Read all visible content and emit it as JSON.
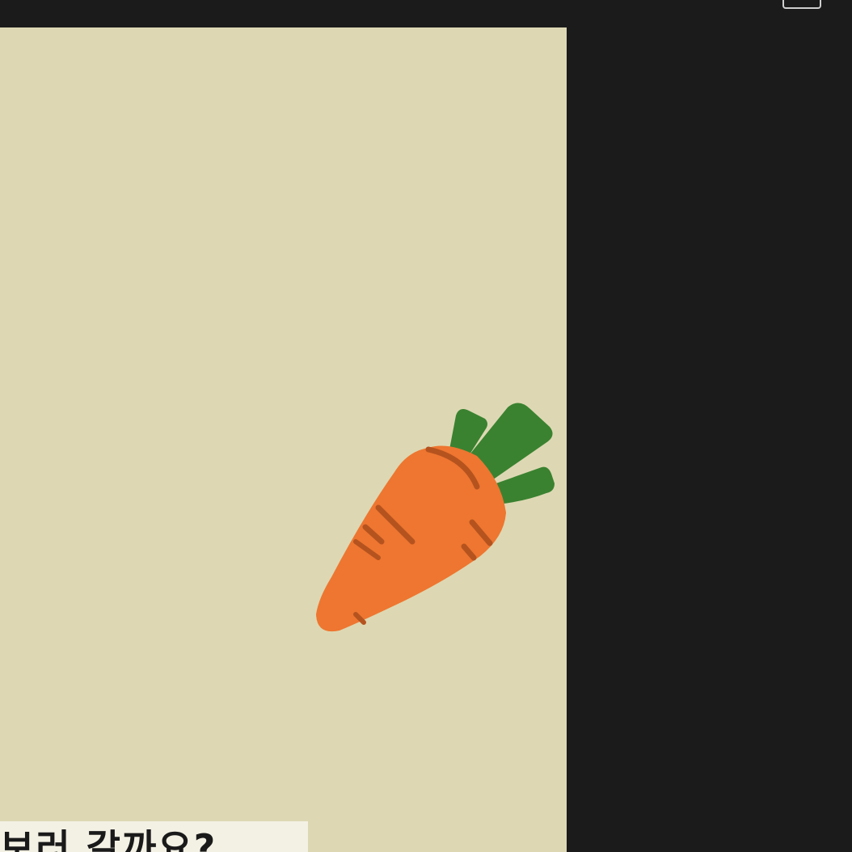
{
  "window": {
    "top_icon": "window-frame-icon"
  },
  "canvas": {
    "background": "#ddd8b3",
    "illustration": "carrot-icon",
    "colors": {
      "carrot_body": "#ee7630",
      "carrot_lines": "#b5531f",
      "carrot_leaves": "#3a8230"
    }
  },
  "caption": {
    "text": "보러 갈까요?"
  }
}
